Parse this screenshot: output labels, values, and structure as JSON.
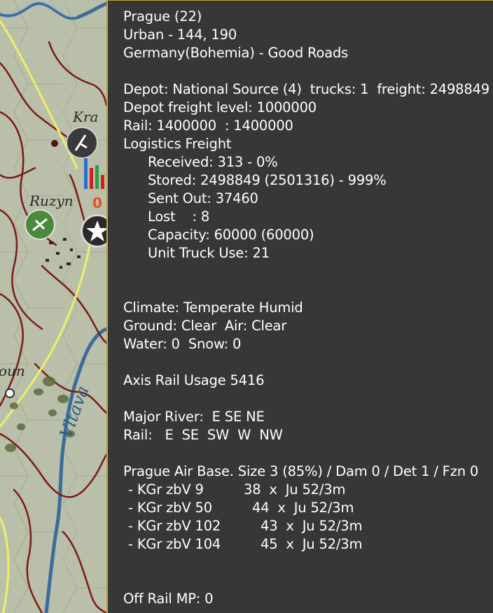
{
  "map": {
    "labels": {
      "krai": "Kra",
      "ruzyn": "Ruzyn",
      "oun": "oun",
      "vltava": "Vltava"
    },
    "badge": "0",
    "icons": [
      "air-unit-icon",
      "supply-bar-icon",
      "fighter-unit-icon",
      "star-hq-icon"
    ]
  },
  "panel": {
    "header": {
      "name": "Prague (22)",
      "terrain": "Urban - 144, 190",
      "nation": "Germany(Bohemia) - Good Roads"
    },
    "depot": {
      "source": "Depot: National Source (4)  trucks: 1  freight: 2498849",
      "freight_level": "Depot freight level: 1000000",
      "rail": "Rail: 1400000  : 1400000",
      "logistics_title": "Logistics Freight",
      "received": "Received: 313 - 0%",
      "stored": "Stored: 2498849 (2501316) - 999%",
      "sent_out": "Sent Out: 37460",
      "lost": "Lost    : 8",
      "capacity": "Capacity: 60000 (60000)",
      "truck_use": "Unit Truck Use: 21"
    },
    "weather": {
      "climate": "Climate: Temperate Humid",
      "ground_air": "Ground: Clear  Air: Clear",
      "water_snow": "Water: 0  Snow: 0"
    },
    "rail_usage": "Axis Rail Usage 5416",
    "connections": {
      "river": "Major River:  E SE NE",
      "rail": "Rail:   E  SE  SW  W  NW"
    },
    "air_base": {
      "title": "Prague Air Base. Size 3 (85%) / Dam 0 / Det 1 / Fzn 0",
      "units": [
        {
          "name": "- KGr zbV 9",
          "count": "38  x  Ju 52/3m"
        },
        {
          "name": "- KGr zbV 50",
          "count": "44  x  Ju 52/3m"
        },
        {
          "name": "- KGr zbV 102",
          "count": "43  x  Ju 52/3m"
        },
        {
          "name": "- KGr zbV 104",
          "count": "45  x  Ju 52/3m"
        }
      ]
    },
    "off_rail": "Off Rail MP: 0"
  }
}
